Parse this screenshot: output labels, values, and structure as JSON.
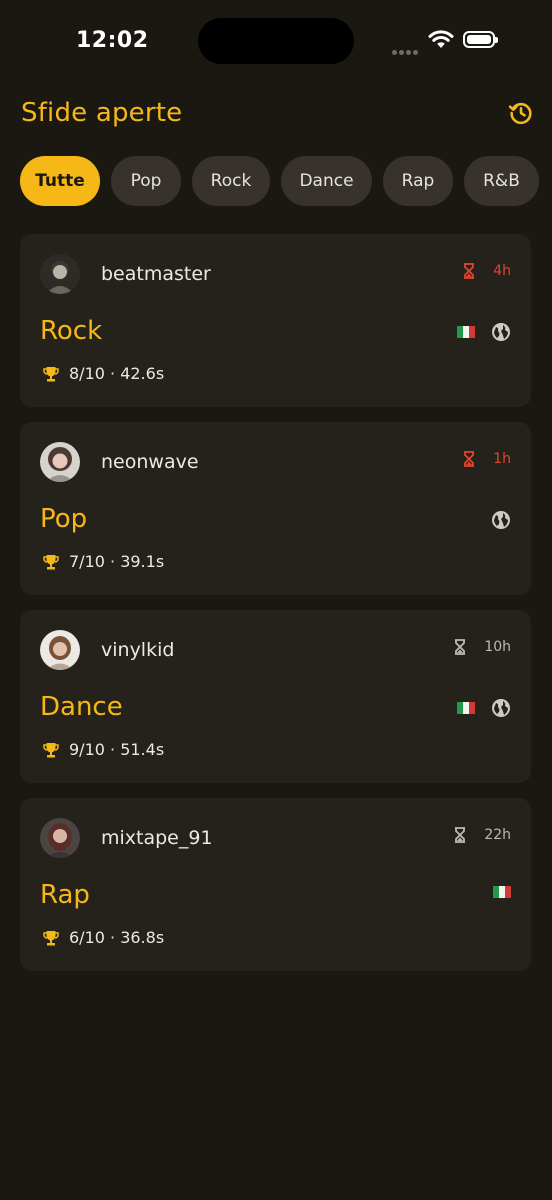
{
  "status_bar": {
    "time": "12:02"
  },
  "header": {
    "title": "Sfide aperte",
    "history_icon": "history-icon"
  },
  "filters": [
    {
      "label": "Tutte",
      "active": true
    },
    {
      "label": "Pop",
      "active": false
    },
    {
      "label": "Rock",
      "active": false
    },
    {
      "label": "Dance",
      "active": false
    },
    {
      "label": "Rap",
      "active": false
    },
    {
      "label": "R&B",
      "active": false
    }
  ],
  "challenges": [
    {
      "username": "beatmaster",
      "time_left": "4h",
      "urgent": true,
      "genre": "Rock",
      "italy": true,
      "global": true,
      "score": "8/10 · 42.6s"
    },
    {
      "username": "neonwave",
      "time_left": "1h",
      "urgent": true,
      "genre": "Pop",
      "italy": false,
      "global": true,
      "score": "7/10 · 39.1s"
    },
    {
      "username": "vinylkid",
      "time_left": "10h",
      "urgent": false,
      "genre": "Dance",
      "italy": true,
      "global": true,
      "score": "9/10 · 51.4s"
    },
    {
      "username": "mixtape_91",
      "time_left": "22h",
      "urgent": false,
      "genre": "Rap",
      "italy": true,
      "global": false,
      "score": "6/10 · 36.8s"
    }
  ],
  "colors": {
    "accent": "#f5b817",
    "urgent": "#e24430",
    "background": "#1b1812",
    "card": "#25221c"
  }
}
